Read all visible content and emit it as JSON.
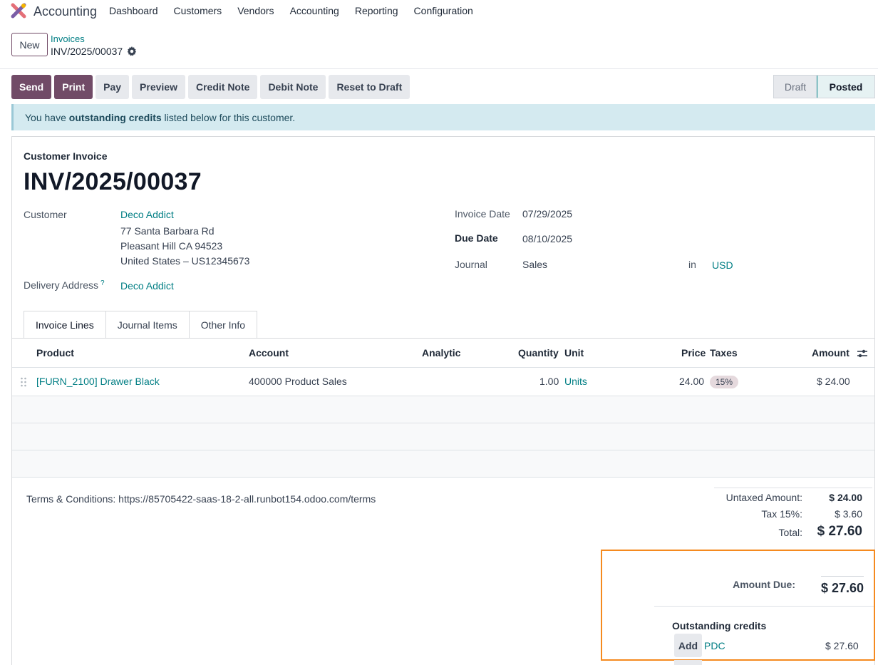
{
  "app": {
    "name": "Accounting",
    "menu": [
      "Dashboard",
      "Customers",
      "Vendors",
      "Accounting",
      "Reporting",
      "Configuration"
    ]
  },
  "breadcrumb": {
    "new_label": "New",
    "parent": "Invoices",
    "current": "INV/2025/00037"
  },
  "actions": {
    "send": "Send",
    "print": "Print",
    "pay": "Pay",
    "preview": "Preview",
    "credit_note": "Credit Note",
    "debit_note": "Debit Note",
    "reset_to_draft": "Reset to Draft"
  },
  "status": {
    "draft": "Draft",
    "posted": "Posted",
    "current": "Posted"
  },
  "alert": {
    "prefix": "You have ",
    "bold": "outstanding credits",
    "suffix": " listed below for this customer."
  },
  "invoice": {
    "type": "Customer Invoice",
    "number": "INV/2025/00037",
    "customer_label": "Customer",
    "customer_name": "Deco Addict",
    "address_line1": "77 Santa Barbara Rd",
    "address_line2": "Pleasant Hill CA 94523",
    "address_line3": "United States – US12345673",
    "delivery_label": "Delivery Address",
    "delivery_help": "?",
    "delivery_value": "Deco Addict",
    "invoice_date_label": "Invoice Date",
    "invoice_date": "07/29/2025",
    "due_date_label": "Due Date",
    "due_date": "08/10/2025",
    "journal_label": "Journal",
    "journal": "Sales",
    "in_label": "in",
    "currency": "USD"
  },
  "tabs": [
    "Invoice Lines",
    "Journal Items",
    "Other Info"
  ],
  "lines": {
    "columns": {
      "product": "Product",
      "account": "Account",
      "analytic": "Analytic",
      "quantity": "Quantity",
      "unit": "Unit",
      "price": "Price",
      "taxes": "Taxes",
      "amount": "Amount"
    },
    "rows": [
      {
        "product": "[FURN_2100] Drawer Black",
        "account": "400000 Product Sales",
        "analytic": "",
        "quantity": "1.00",
        "unit": "Units",
        "price": "24.00",
        "taxes": "15%",
        "amount": "$ 24.00"
      }
    ]
  },
  "terms": "Terms & Conditions: https://85705422-saas-18-2-all.runbot154.odoo.com/terms",
  "totals": {
    "untaxed_label": "Untaxed Amount:",
    "untaxed": "$ 24.00",
    "tax_label": "Tax 15%:",
    "tax": "$ 3.60",
    "total_label": "Total:",
    "total": "$ 27.60",
    "due_label": "Amount Due:",
    "due": "$ 27.60"
  },
  "outstanding": {
    "title": "Outstanding credits",
    "add_label": "Add",
    "ref": "PDC",
    "amount": "$ 27.60"
  },
  "colors": {
    "primary": "#714b67",
    "link": "#017e84",
    "highlight": "#f58a1f",
    "alert_bg": "#d4eaf0"
  }
}
